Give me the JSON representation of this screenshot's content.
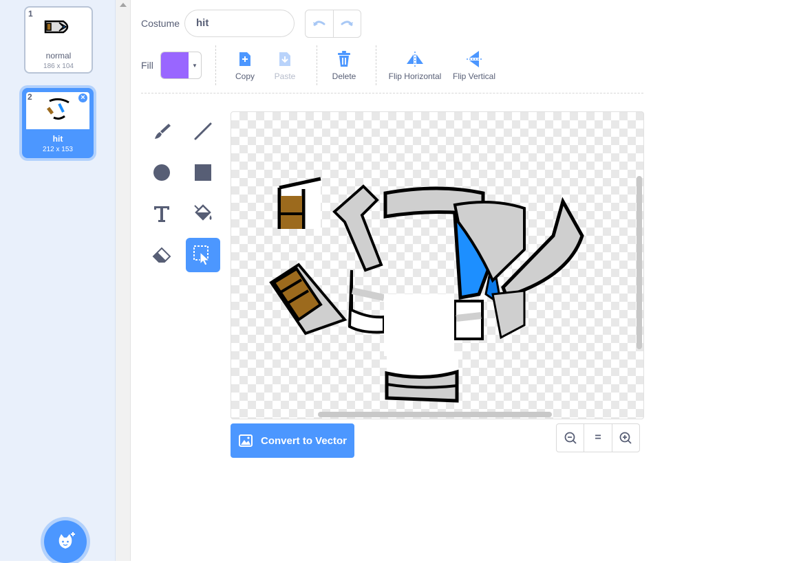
{
  "costumes": [
    {
      "number": "1",
      "name": "normal",
      "size": "186 x 104",
      "selected": false
    },
    {
      "number": "2",
      "name": "hit",
      "size": "212 x 153",
      "selected": true
    }
  ],
  "toolbar": {
    "costume_label": "Costume",
    "costume_name": "hit",
    "fill_label": "Fill",
    "fill_color": "#9966ff",
    "copy_label": "Copy",
    "paste_label": "Paste",
    "delete_label": "Delete",
    "flip_h_label": "Flip Horizontal",
    "flip_v_label": "Flip Vertical"
  },
  "tools": [
    "brush-icon",
    "line-icon",
    "circle-icon",
    "rectangle-icon",
    "text-icon",
    "fill-bucket-icon",
    "eraser-icon",
    "select-icon"
  ],
  "active_tool": "select",
  "convert_label": "Convert to Vector",
  "zoom": {
    "out": "−",
    "reset": "=",
    "in": "+"
  },
  "colors": {
    "accent": "#4c97ff",
    "text": "#575e75"
  }
}
